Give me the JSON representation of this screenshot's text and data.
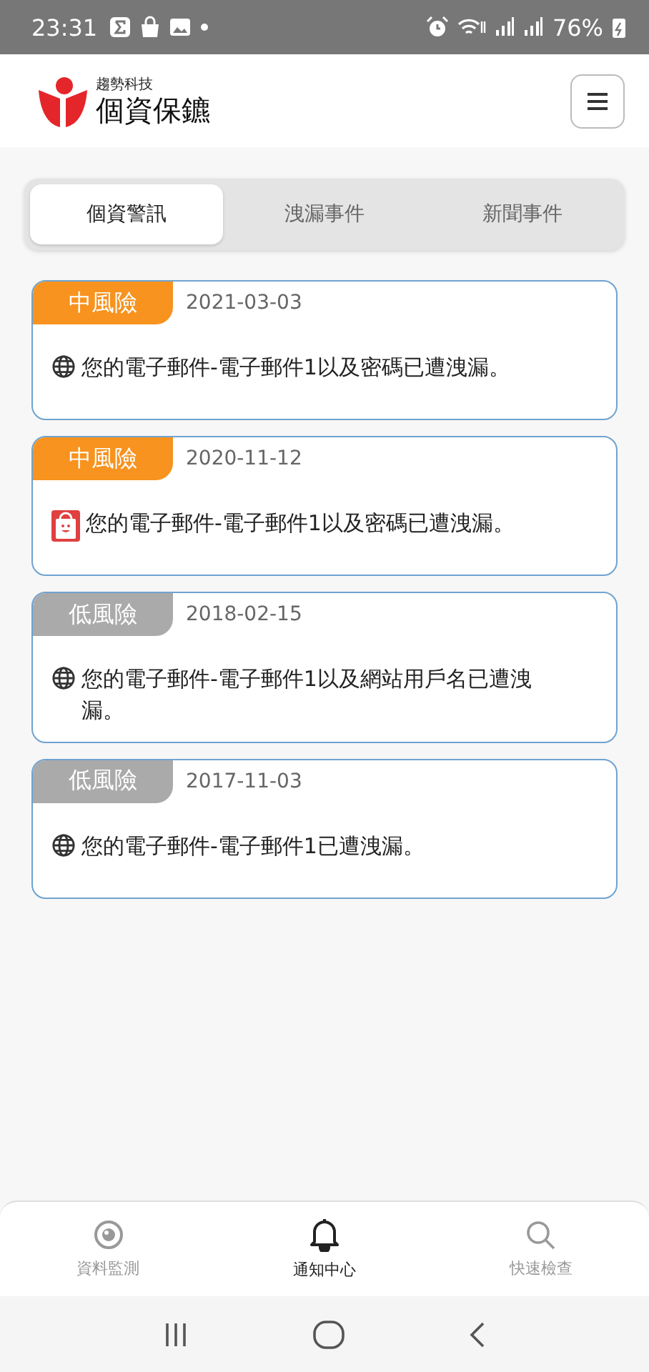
{
  "status_bar": {
    "time": "23:31",
    "battery": "76%"
  },
  "header": {
    "company": "趨勢科技",
    "app_name": "個資保鑣"
  },
  "tabs": [
    {
      "label": "個資警訊",
      "selected": true
    },
    {
      "label": "洩漏事件",
      "selected": false
    },
    {
      "label": "新聞事件",
      "selected": false
    }
  ],
  "alerts": [
    {
      "risk": {
        "label": "中風險",
        "kind": "medium"
      },
      "date": "2021-03-03",
      "source": {
        "kind": "globe"
      },
      "message": "您的電子郵件-電子郵件1以及密碼已遭洩漏。"
    },
    {
      "risk": {
        "label": "中風險",
        "kind": "medium"
      },
      "date": "2020-11-12",
      "source": {
        "kind": "app"
      },
      "message": "您的電子郵件-電子郵件1以及密碼已遭洩漏。"
    },
    {
      "risk": {
        "label": "低風險",
        "kind": "low"
      },
      "date": "2018-02-15",
      "source": {
        "kind": "globe"
      },
      "message": "您的電子郵件-電子郵件1以及網站用戶名已遭洩漏。"
    },
    {
      "risk": {
        "label": "低風險",
        "kind": "low"
      },
      "date": "2017-11-03",
      "source": {
        "kind": "globe"
      },
      "message": "您的電子郵件-電子郵件1已遭洩漏。"
    }
  ],
  "bottom_nav": [
    {
      "label": "資料監測",
      "kind": "eye",
      "selected": false
    },
    {
      "label": "通知中心",
      "kind": "bell",
      "selected": true
    },
    {
      "label": "快速檢查",
      "kind": "search",
      "selected": false
    }
  ]
}
